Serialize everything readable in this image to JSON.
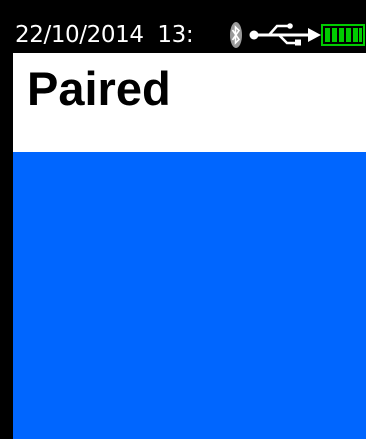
{
  "status_bar": {
    "date": "22/10/2014",
    "time": "13:",
    "icons": [
      "bluetooth-icon",
      "usb-icon",
      "battery-icon"
    ],
    "battery_color": "#00cc00"
  },
  "header": {
    "title": "Paired"
  },
  "colors": {
    "background": "#000000",
    "header_bg": "#ffffff",
    "content_bg": "#0066ff",
    "status_text": "#ffffff"
  }
}
